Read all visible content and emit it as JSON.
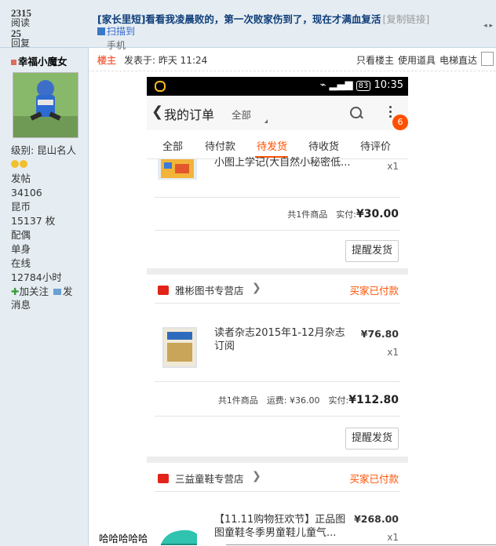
{
  "sidebar": {
    "views_count": "2315",
    "views_label": "阅读",
    "replies_count": "25",
    "replies_label": "回复",
    "author_name": "幸福小魔女",
    "level_label": "级别: 昆山名人",
    "stats": [
      {
        "label": "发帖",
        "value": "34106"
      },
      {
        "label": "昆币",
        "value": "15137 枚"
      },
      {
        "label": "配偶",
        "value": "单身"
      },
      {
        "label": "在线",
        "value": "12784小时"
      }
    ],
    "actions": {
      "follow": "加关注",
      "message": "发消息"
    }
  },
  "thread": {
    "title": "[家长里短]看看我凌晨败的，第一次败家伤到了，现在才满血复活",
    "copy_link": "[复制链接]",
    "scan_label": "扫描到",
    "phone_label": "手机"
  },
  "post": {
    "op_badge": "楼主",
    "posted_at": "发表于: 昨天 11:24",
    "tools": [
      "只看楼主",
      "使用道具",
      "电梯直达"
    ],
    "footer_text": "哈哈哈哈哈"
  },
  "phone": {
    "status_time": "10:35",
    "status_battery": "83",
    "nav_title": "我的订单",
    "nav_filter": "全部",
    "badge_count": "6",
    "tabs": [
      "全部",
      "待付款",
      "待发货",
      "待收货",
      "待评价"
    ],
    "active_tab": "待发货",
    "orders": [
      {
        "product": "小图上学记(大自然小秘密低...",
        "qty": "x1",
        "summary_count": "共1件商品",
        "summary_label": "实付:",
        "total": "¥30.00",
        "remind": "提醒发货"
      },
      {
        "shop": "雅彬图书专营店",
        "status": "买家已付款",
        "product": "读者杂志2015年1-12月杂志订阅",
        "price": "¥76.80",
        "qty": "x1",
        "summary_count": "共1件商品",
        "shipping": "运费: ¥36.00",
        "summary_label": "实付:",
        "total": "¥112.80",
        "remind": "提醒发货"
      },
      {
        "shop": "三益童鞋专营店",
        "status": "买家已付款",
        "product": "【11.11购物狂欢节】正品图图童鞋冬季男童鞋儿童气...",
        "price": "¥268.00",
        "qty": "x1"
      }
    ]
  }
}
